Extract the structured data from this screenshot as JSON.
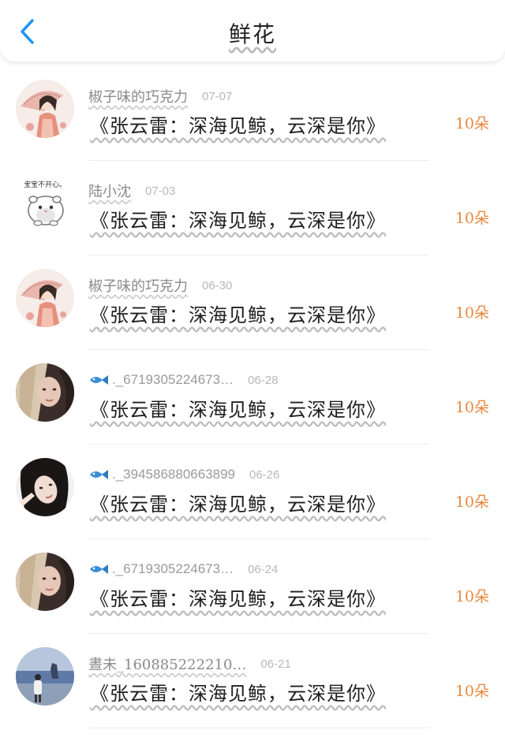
{
  "header": {
    "title": "鲜花",
    "back_icon": "chevron-left-icon",
    "accent_color": "#2196f3"
  },
  "records": [
    {
      "name": "椒子味的巧克力",
      "date": "07-07",
      "gift": "《张云雷：深海见鲸，云深是你》",
      "amount": "10朵",
      "badge": false,
      "avatar": "girl-umbrella"
    },
    {
      "name": "陆小沈",
      "date": "07-03",
      "gift": "《张云雷：深海见鲸，云深是你》",
      "amount": "10朵",
      "badge": false,
      "avatar": "hamster",
      "avatar_caption": "宝宝不开心。"
    },
    {
      "name": "椒子味的巧克力",
      "date": "06-30",
      "gift": "《张云雷：深海见鲸，云深是你》",
      "amount": "10朵",
      "badge": false,
      "avatar": "girl-umbrella"
    },
    {
      "name": "._67193052246​73…",
      "date": "06-28",
      "gift": "《张云雷：深海见鲸，云深是你》",
      "amount": "10朵",
      "badge": true,
      "avatar": "blonde-girl"
    },
    {
      "name": "._394586880663899",
      "date": "06-26",
      "gift": "《张云雷：深海见鲸，云深是你》",
      "amount": "10朵",
      "badge": true,
      "avatar": "dark-hair-girl"
    },
    {
      "name": "._6719305224673…",
      "date": "06-24",
      "gift": "《张云雷：深海见鲸，云深是你》",
      "amount": "10朵",
      "badge": true,
      "avatar": "blonde-girl"
    },
    {
      "name": "晝未_160885222210…",
      "date": "06-21",
      "gift": "《张云雷：深海见鲸，云深是你》",
      "amount": "10朵",
      "badge": false,
      "avatar": "beach"
    }
  ],
  "badge_icon": "fish-icon",
  "amount_color": "#e8893f"
}
